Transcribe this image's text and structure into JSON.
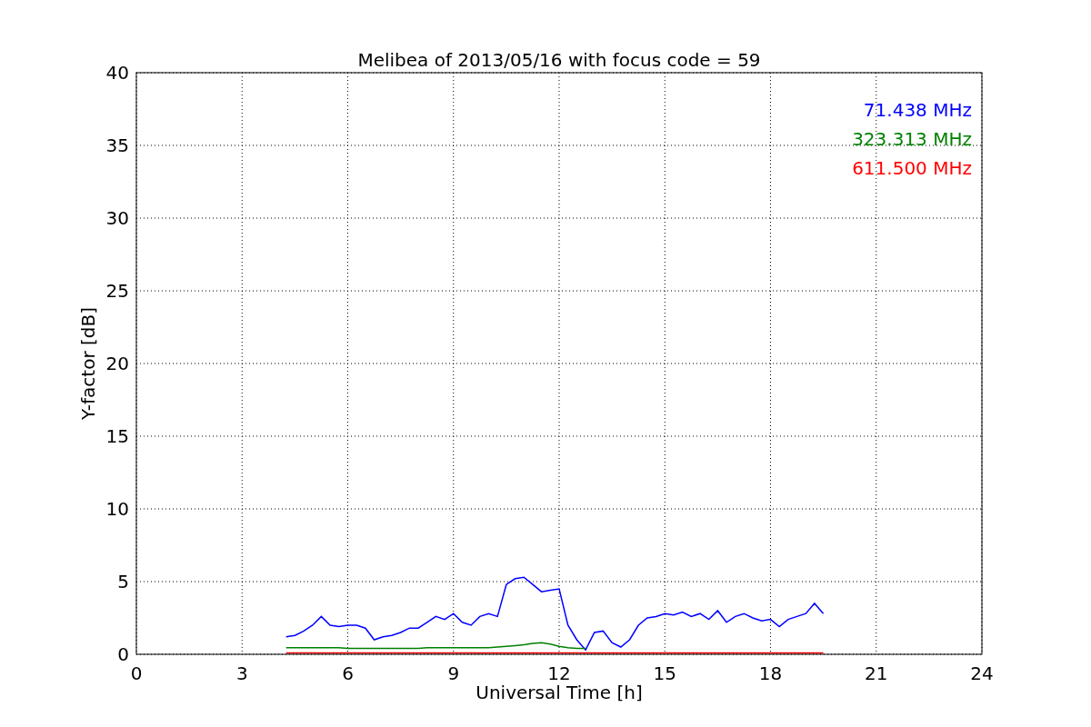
{
  "chart_data": {
    "type": "line",
    "grid": true,
    "title": "Melibea of 2013/05/16 with focus code = 59",
    "xlabel": "Universal Time [h]",
    "ylabel": "Y-factor [dB]",
    "xlim": [
      0,
      24
    ],
    "ylim": [
      0,
      40
    ],
    "xticks": [
      0,
      3,
      6,
      9,
      12,
      15,
      18,
      21,
      24
    ],
    "yticks": [
      0,
      5,
      10,
      15,
      20,
      25,
      30,
      35,
      40
    ],
    "x": [
      4.25,
      4.5,
      4.75,
      5,
      5.25,
      5.5,
      5.75,
      6,
      6.25,
      6.5,
      6.75,
      7,
      7.25,
      7.5,
      7.75,
      8,
      8.25,
      8.5,
      8.75,
      9,
      9.25,
      9.5,
      9.75,
      10,
      10.25,
      10.5,
      10.75,
      11,
      11.25,
      11.5,
      11.75,
      12,
      12.25,
      12.5,
      12.75,
      13,
      13.25,
      13.5,
      13.75,
      14,
      14.25,
      14.5,
      14.75,
      15,
      15.25,
      15.5,
      15.75,
      16,
      16.25,
      16.5,
      16.75,
      17,
      17.25,
      17.5,
      17.75,
      18,
      18.25,
      18.5,
      18.75,
      19,
      19.25,
      19.5
    ],
    "series": [
      {
        "name": "71.438 MHz",
        "color": "#0000ff",
        "values": [
          1.2,
          1.3,
          1.6,
          2.0,
          2.6,
          2.0,
          1.9,
          2.0,
          2.0,
          1.8,
          1.0,
          1.2,
          1.3,
          1.5,
          1.8,
          1.8,
          2.2,
          2.6,
          2.4,
          2.8,
          2.2,
          2.0,
          2.6,
          2.8,
          2.6,
          4.8,
          5.2,
          5.3,
          4.8,
          4.3,
          4.4,
          4.5,
          2.0,
          1.0,
          0.3,
          1.5,
          1.6,
          0.8,
          0.5,
          1.0,
          2.0,
          2.5,
          2.6,
          2.8,
          2.7,
          2.9,
          2.6,
          2.8,
          2.4,
          3.0,
          2.2,
          2.6,
          2.8,
          2.5,
          2.3,
          2.4,
          1.9,
          2.4,
          2.6,
          2.8,
          3.5,
          2.8
        ]
      },
      {
        "name": "323.313 MHz",
        "color": "#008000",
        "values": [
          0.45,
          0.45,
          0.45,
          0.45,
          0.45,
          0.45,
          0.45,
          0.4,
          0.4,
          0.4,
          0.4,
          0.4,
          0.4,
          0.4,
          0.4,
          0.4,
          0.45,
          0.45,
          0.45,
          0.45,
          0.45,
          0.45,
          0.45,
          0.45,
          0.5,
          0.55,
          0.6,
          0.65,
          0.75,
          0.8,
          0.7,
          0.55,
          0.45,
          0.4,
          0.4,
          null,
          null,
          null,
          null,
          null,
          null,
          null,
          null,
          null,
          null,
          null,
          null,
          null,
          null,
          null,
          null,
          null,
          null,
          null,
          null,
          null,
          null,
          null,
          null,
          null,
          null,
          null
        ]
      },
      {
        "name": "611.500 MHz",
        "color": "#ff0000",
        "values": [
          0.1,
          0.1,
          0.1,
          0.1,
          0.1,
          0.1,
          0.1,
          0.1,
          0.1,
          0.1,
          0.1,
          0.1,
          0.1,
          0.1,
          0.1,
          0.1,
          0.1,
          0.1,
          0.1,
          0.1,
          0.1,
          0.1,
          0.1,
          0.1,
          0.1,
          0.1,
          0.1,
          0.1,
          0.1,
          0.1,
          0.1,
          0.1,
          0.1,
          0.1,
          0.1,
          0.1,
          0.1,
          0.1,
          0.1,
          0.1,
          0.1,
          0.1,
          0.1,
          0.1,
          0.1,
          0.1,
          0.1,
          0.1,
          0.1,
          0.1,
          0.1,
          0.1,
          0.1,
          0.1,
          0.1,
          0.1,
          0.1,
          0.1,
          0.1,
          0.1,
          0.1,
          0.1
        ]
      }
    ]
  }
}
